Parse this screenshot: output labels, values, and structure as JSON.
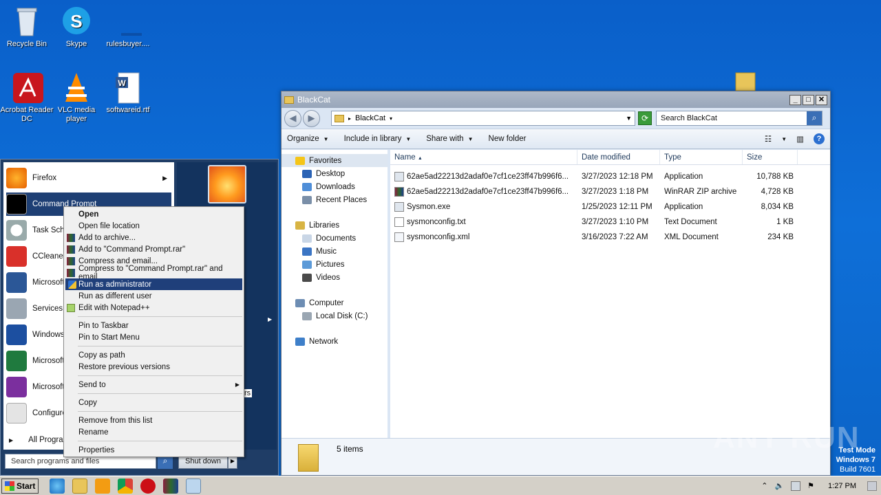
{
  "desktop": {
    "icons": [
      {
        "label": "Recycle Bin"
      },
      {
        "label": "Skype"
      },
      {
        "label": "rulesbuyer...."
      },
      {
        "label": "Acrobat Reader DC"
      },
      {
        "label": "VLC media player"
      },
      {
        "label": "softwareid.rtf"
      }
    ]
  },
  "explorer": {
    "title": "BlackCat",
    "address": "BlackCat",
    "search_placeholder": "Search BlackCat",
    "toolbar": {
      "organize": "Organize",
      "include": "Include in library",
      "share": "Share with",
      "new_folder": "New folder"
    },
    "nav": {
      "favorites": "Favorites",
      "desktop": "Desktop",
      "downloads": "Downloads",
      "recent": "Recent Places",
      "libraries": "Libraries",
      "documents": "Documents",
      "music": "Music",
      "pictures": "Pictures",
      "videos": "Videos",
      "computer": "Computer",
      "local_disk": "Local Disk (C:)",
      "network": "Network"
    },
    "columns": {
      "name": "Name",
      "date": "Date modified",
      "type": "Type",
      "size": "Size"
    },
    "files": [
      {
        "name": "62ae5ad22213d2adaf0e7cf1ce23ff47b996f6...",
        "date": "3/27/2023 12:18 PM",
        "type": "Application",
        "size": "10,788 KB"
      },
      {
        "name": "62ae5ad22213d2adaf0e7cf1ce23ff47b996f6...",
        "date": "3/27/2023 1:18 PM",
        "type": "WinRAR ZIP archive",
        "size": "4,728 KB"
      },
      {
        "name": "Sysmon.exe",
        "date": "1/25/2023 12:11 PM",
        "type": "Application",
        "size": "8,034 KB"
      },
      {
        "name": "sysmonconfig.txt",
        "date": "3/27/2023 1:10 PM",
        "type": "Text Document",
        "size": "1 KB"
      },
      {
        "name": "sysmonconfig.xml",
        "date": "3/16/2023 7:22 AM",
        "type": "XML Document",
        "size": "234 KB"
      }
    ],
    "status": "5 items"
  },
  "startmenu": {
    "items": [
      {
        "label": "Firefox",
        "color": "#f07a1c"
      },
      {
        "label": "Command Prompt",
        "color": "#111111"
      },
      {
        "label": "Task Sch",
        "color": "#c0c0c0"
      },
      {
        "label": "CCleaner",
        "color": "#d9302a"
      },
      {
        "label": "Microsoft",
        "color": "#2b5797"
      },
      {
        "label": "Services",
        "color": "#9aa6b2"
      },
      {
        "label": "Windows",
        "color": "#1c4fa0"
      },
      {
        "label": "Microsoft",
        "color": "#1f7a3e"
      },
      {
        "label": "Microsoft",
        "color": "#7b2f9e"
      },
      {
        "label": "Configure",
        "color": "#e4e4e4"
      }
    ],
    "all_programs": "All Progra",
    "right_fragment": "rs",
    "search_placeholder": "Search programs and files",
    "shutdown": "Shut down"
  },
  "context_menu": {
    "items": [
      {
        "label": "Open",
        "kind": "bold"
      },
      {
        "label": "Open file location"
      },
      {
        "label": "Add to archive..."
      },
      {
        "label": "Add to \"Command Prompt.rar\""
      },
      {
        "label": "Compress and email..."
      },
      {
        "label": "Compress to \"Command Prompt.rar\" and email"
      },
      {
        "label": "Run as administrator",
        "kind": "highlight"
      },
      {
        "label": "Run as different user"
      },
      {
        "label": "Edit with Notepad++"
      },
      {
        "label": "Pin to Taskbar"
      },
      {
        "label": "Pin to Start Menu"
      },
      {
        "label": "Copy as path"
      },
      {
        "label": "Restore previous versions"
      },
      {
        "label": "Send to"
      },
      {
        "label": "Copy"
      },
      {
        "label": "Remove from this list"
      },
      {
        "label": "Rename"
      },
      {
        "label": "Properties"
      }
    ]
  },
  "taskbar": {
    "start": "Start",
    "clock": "1:27 PM"
  },
  "watermark": {
    "line1": "Test Mode",
    "line2": "Windows 7",
    "line3": "Build 7601",
    "brand": "ANY RUN"
  }
}
